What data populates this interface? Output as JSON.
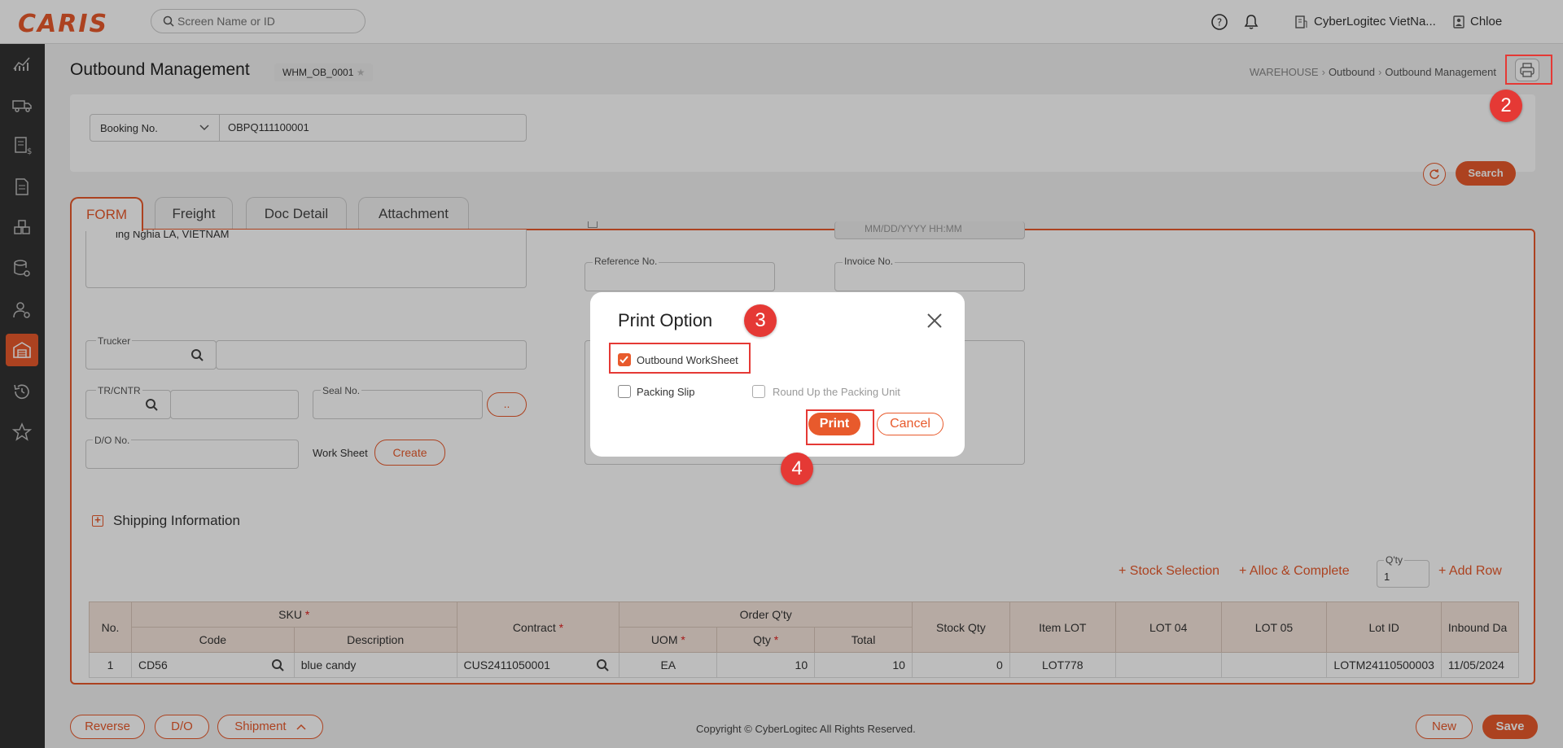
{
  "app": {
    "logo": "CARIS"
  },
  "header": {
    "search_placeholder": "Screen Name or ID",
    "company": "CyberLogitec VietNa...",
    "user": "Chloe"
  },
  "page": {
    "title": "Outbound Management",
    "screen_id": "WHM_OB_0001",
    "breadcrumb": [
      "WAREHOUSE",
      "Outbound",
      "Outbound Management"
    ]
  },
  "search": {
    "field_select": "Booking No.",
    "field_value": "OBPQ111100001",
    "search_label": "Search"
  },
  "tabs": [
    "FORM",
    "Freight",
    "Doc Detail",
    "Attachment"
  ],
  "form": {
    "address_text": "ing Nghia LA, VIETNAM",
    "date_placeholder": "MM/DD/YYYY HH:MM",
    "reference_label": "Reference No.",
    "invoice_label": "Invoice No.",
    "trucker_label": "Trucker",
    "tr_cntr_label": "TR/CNTR",
    "seal_label": "Seal No.",
    "dots_label": "..",
    "do_label": "D/O No.",
    "worksheet_label": "Work Sheet",
    "create_label": "Create",
    "shipping_info_label": "Shipping Information",
    "stock_selection": "Stock Selection",
    "alloc_complete": "Alloc & Complete",
    "qty_label": "Q'ty",
    "qty_value": "1",
    "add_row": "Add Row"
  },
  "table": {
    "group_headers": {
      "sku": "SKU",
      "order_qty": "Order Q'ty"
    },
    "headers": {
      "no": "No.",
      "code": "Code",
      "description": "Description",
      "contract": "Contract",
      "uom": "UOM",
      "qty": "Qty",
      "total": "Total",
      "stock_qty": "Stock Qty",
      "item_lot": "Item LOT",
      "lot04": "LOT 04",
      "lot05": "LOT 05",
      "lot_id": "Lot ID",
      "inbound_date": "Inbound Da"
    },
    "rows": [
      {
        "no": "1",
        "code": "CD56",
        "description": "blue candy",
        "contract": "CUS2411050001",
        "uom": "EA",
        "qty": "10",
        "total": "10",
        "stock_qty": "0",
        "item_lot": "LOT778",
        "lot04": "",
        "lot05": "",
        "lot_id": "LOTM24110500003",
        "inbound_date": "11/05/2024"
      }
    ]
  },
  "footer": {
    "reverse": "Reverse",
    "do": "D/O",
    "shipment": "Shipment",
    "copyright": "Copyright © CyberLogitec All Rights Reserved.",
    "new": "New",
    "save": "Save"
  },
  "modal": {
    "title": "Print Option",
    "options": [
      {
        "label": "Outbound WorkSheet",
        "checked": true,
        "disabled": false
      },
      {
        "label": "Packing Slip",
        "checked": false,
        "disabled": false
      },
      {
        "label": "Round Up the Packing Unit",
        "checked": false,
        "disabled": true
      }
    ],
    "print_label": "Print",
    "cancel_label": "Cancel"
  },
  "annotations": {
    "step2": "2",
    "step3": "3",
    "step4": "4"
  },
  "colors": {
    "accent": "#e85a2c",
    "annotation": "#e53935",
    "sidebar": "#333333"
  }
}
